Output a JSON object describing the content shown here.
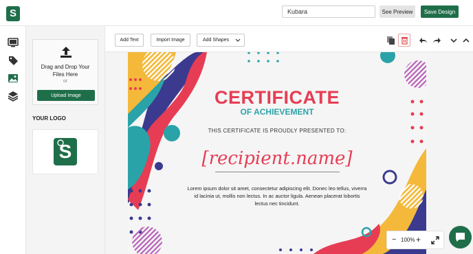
{
  "app": {
    "logo_letter": "S",
    "brand_color": "#1f6e4a"
  },
  "header": {
    "design_name": "Kubara",
    "preview_label": "See Preview",
    "save_label": "Save Design"
  },
  "sidebar_icons": [
    "monitor-icon",
    "tag-icon",
    "image-icon",
    "layers-icon"
  ],
  "panel": {
    "upload_title_line1": "Drag and Drop Your",
    "upload_title_line2": "Files Here",
    "upload_or": "or",
    "upload_button": "Upload Image",
    "your_logo_label": "YOUR LOGO",
    "logo_letter": "S"
  },
  "toolbar": {
    "add_text": "Add Text",
    "import_image": "Import Image",
    "add_shapes": "Add Shapes",
    "icons": [
      "duplicate-icon",
      "delete-icon",
      "undo-icon",
      "redo-icon",
      "move-down-icon",
      "move-up-icon"
    ]
  },
  "certificate": {
    "title": "CERTIFICATE",
    "subtitle": "OF ACHIEVEMENT",
    "presented": "THIS CERTIFICATE IS PROUDLY PRESENTED TO:",
    "recipient": "[recipient.name]",
    "body": "Lorem ipsum dolor sit amet, consectetur adipiscing elit. Donec leo tellus, viverra id lacinia ut, mollis non lectus. In ac auctor ligula. Aenean placerat lobortis lectus nec tincidunt.",
    "colors": {
      "red": "#e63d54",
      "teal": "#2aa3a8",
      "navy": "#3b3a8f",
      "yellow": "#f4b93b"
    }
  },
  "zoom": {
    "minus": "−",
    "level": "100%",
    "plus": "+"
  }
}
